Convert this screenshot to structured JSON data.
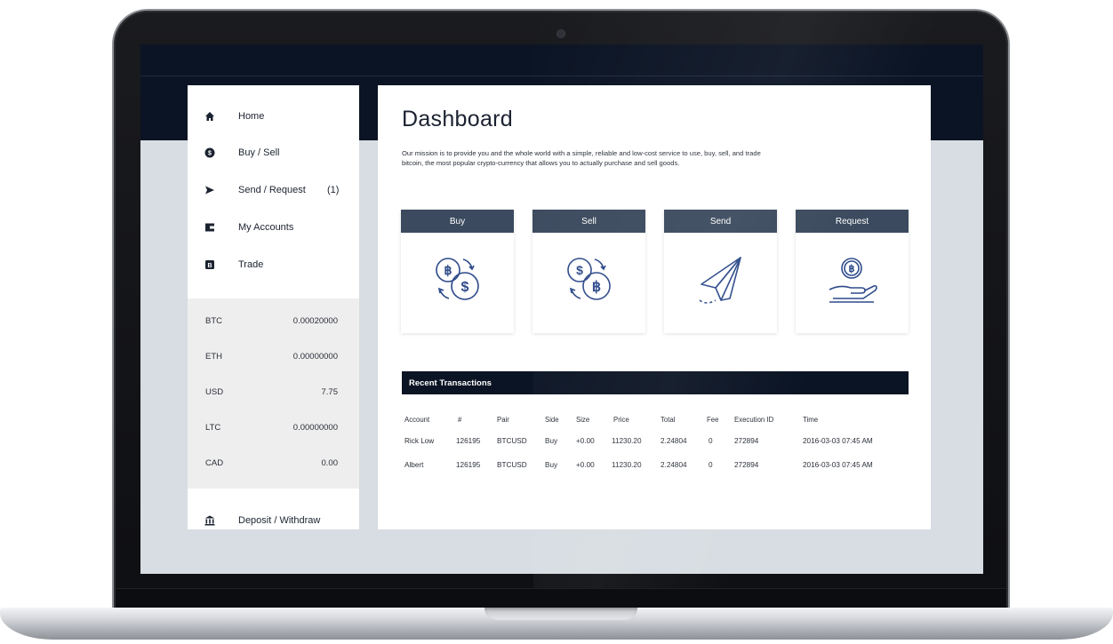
{
  "nav": {
    "items": [
      {
        "label": "Home",
        "icon": "home-icon",
        "badge": ""
      },
      {
        "label": "Buy / Sell",
        "icon": "coin-icon",
        "badge": ""
      },
      {
        "label": "Send / Request",
        "icon": "send-icon",
        "badge": "(1)"
      },
      {
        "label": "My Accounts",
        "icon": "wallet-icon",
        "badge": ""
      },
      {
        "label": "Trade",
        "icon": "trade-icon",
        "badge": ""
      }
    ],
    "footer_label": "Deposit / Withdraw",
    "footer_icon": "bank-icon"
  },
  "balances": [
    {
      "currency": "BTC",
      "value": "0.00020000"
    },
    {
      "currency": "ETH",
      "value": "0.00000000"
    },
    {
      "currency": "USD",
      "value": "7.75"
    },
    {
      "currency": "LTC",
      "value": "0.00000000"
    },
    {
      "currency": "CAD",
      "value": "0.00"
    }
  ],
  "main": {
    "title": "Dashboard",
    "mission_line1": "Our mission is to provide you and the whole world with a simple, reliable and low-cost service to use, buy, sell, and trade",
    "mission_line2": "bitcoin, the most popular crypto-currency that allows you to actually purchase and sell goods."
  },
  "cards": [
    {
      "label": "Buy",
      "icon": "buy-bitcoin-icon"
    },
    {
      "label": "Sell",
      "icon": "sell-bitcoin-icon"
    },
    {
      "label": "Send",
      "icon": "paper-plane-icon"
    },
    {
      "label": "Request",
      "icon": "hand-coin-icon"
    }
  ],
  "transactions": {
    "title": "Recent Transactions",
    "columns": [
      "Account",
      "#",
      "Pair",
      "Side",
      "Size",
      "Price",
      "Total",
      "Fee",
      "Execution ID",
      "Time"
    ],
    "rows": [
      [
        "Rick Low",
        "126195",
        "BTCUSD",
        "Buy",
        "+0.00",
        "11230.20",
        "2.24804",
        "0",
        "272894",
        "2016-03-03 07:45 AM"
      ],
      [
        "Albert",
        "126195",
        "BTCUSD",
        "Buy",
        "+0.00",
        "11230.20",
        "2.24804",
        "0",
        "272894",
        "2016-03-03 07:45 AM"
      ]
    ]
  },
  "colors": {
    "navy": "#0b1424",
    "card_header": "#3b4a5e",
    "icon_blue": "#2d4a8a",
    "screen_bg": "#d7dde2"
  }
}
